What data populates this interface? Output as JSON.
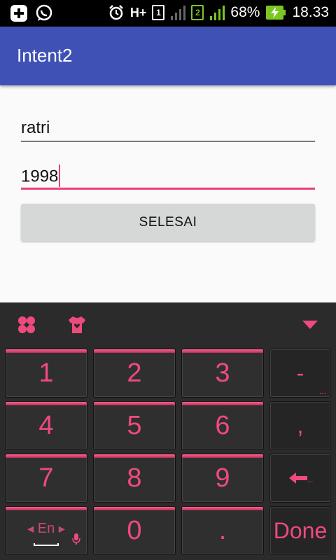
{
  "status_bar": {
    "network_type": "H+",
    "sim1": "1",
    "sim2": "2",
    "battery": "68%",
    "time": "18.33",
    "icons": [
      "plus-icon",
      "whatsapp-icon",
      "alarm-icon",
      "signal-icon",
      "battery-charging-icon"
    ]
  },
  "app_bar": {
    "title": "Intent2"
  },
  "form": {
    "name_value": "ratri",
    "year_value": "1998",
    "submit_label": "SELESAI"
  },
  "keyboard": {
    "toolbar_icons": [
      "clover-icon",
      "shirt-heart-icon",
      "collapse-triangle-icon"
    ],
    "keys": [
      "1",
      "2",
      "3",
      "-",
      "4",
      "5",
      "6",
      ",",
      "7",
      "8",
      "9",
      "enter-icon",
      "En",
      "0",
      ".",
      "Done"
    ],
    "language": "En",
    "done_label": "Done",
    "accent": "#ee4a7d"
  },
  "colors": {
    "app_bar": "#3f51b5",
    "focus_underline": "#e83e7a",
    "button_bg": "#d6d7d7",
    "keyboard_bg": "#2b2b2b"
  }
}
